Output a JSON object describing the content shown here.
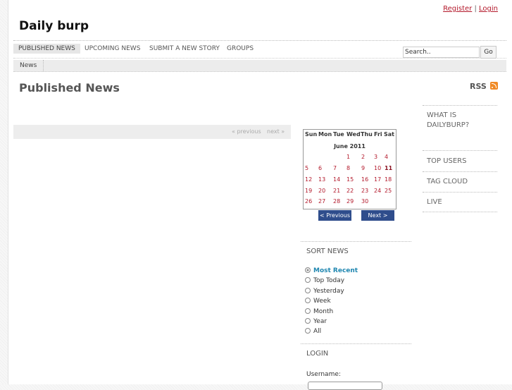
{
  "top_links": {
    "register": "Register",
    "separator": "|",
    "login": "Login"
  },
  "site_title": "Daily burp",
  "nav": {
    "items": [
      "PUBLISHED NEWS",
      "UPCOMING NEWS",
      "SUBMIT A NEW STORY",
      "GROUPS"
    ],
    "active_index": 0
  },
  "search": {
    "value": "Search..",
    "button": "Go"
  },
  "subnav": {
    "items": [
      "News"
    ]
  },
  "page_title": "Published News",
  "rss_label": "RSS",
  "pager": {
    "previous": "« previous",
    "next": "next »"
  },
  "calendar": {
    "weekdays": [
      "Sun",
      "Mon",
      "Tue",
      "Wed",
      "Thu",
      "Fri",
      "Sat"
    ],
    "month": "June 2011",
    "first_weekday_index": 3,
    "days_in_month": 30,
    "today": 11,
    "prev_button": "< Previous",
    "next_button": "Next >"
  },
  "sort_news": {
    "heading": "SORT NEWS",
    "options": [
      "Most Recent",
      "Top Today",
      "Yesterday",
      "Week",
      "Month",
      "Year",
      "All"
    ],
    "selected_index": 0
  },
  "login": {
    "heading": "LOGIN",
    "username_label": "Username:"
  },
  "right_sidebar": {
    "items": [
      "WHAT IS DAILYBURP?",
      "TOP USERS",
      "TAG CLOUD",
      "LIVE"
    ]
  },
  "colors": {
    "link_red": "#b3192b",
    "button_blue": "#2f4d8c",
    "selected_teal": "#1e86b0",
    "rss_orange": "#f08a26"
  }
}
